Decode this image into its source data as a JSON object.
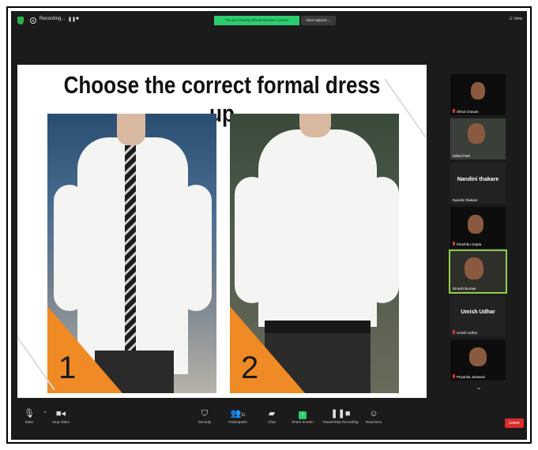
{
  "topbar": {
    "recording_label": "Recording...",
    "pause_label": "❚❚",
    "stop_label": "■",
    "share_banner": "You are viewing Dinesh Burase's screen",
    "view_options": "View Options ⌄",
    "view_label": "☷ View"
  },
  "slide": {
    "title": "Choose the correct formal dress up",
    "option1": "1",
    "option2": "2"
  },
  "participants": [
    {
      "name": "Shruti chavan",
      "type": "video"
    },
    {
      "name": "Milind Patil",
      "type": "video"
    },
    {
      "name": "Nandini thakare",
      "display": "Nandini thakare",
      "type": "name"
    },
    {
      "name": "Khushbu Gupta",
      "type": "video"
    },
    {
      "name": "Dinesh Burase",
      "type": "video",
      "active": true
    },
    {
      "name": "Umish Udhar",
      "display": "Umish Udhar",
      "type": "name"
    },
    {
      "name": "Priyanka Jaiswani",
      "type": "video"
    }
  ],
  "toolbar": {
    "mute": "Mute",
    "stop_video": "Stop Video",
    "security": "Security",
    "participants": "Participants",
    "participants_count": "11",
    "chat": "Chat",
    "share_screen": "Share Screen",
    "pause_recording": "Pause/Stop Recording",
    "reactions": "Reactions",
    "leave": "Leave"
  },
  "colors": {
    "accent_green": "#2ecc71",
    "leave_red": "#d92d2d",
    "orange": "#f08a24",
    "active_border": "#8fcf4b"
  }
}
